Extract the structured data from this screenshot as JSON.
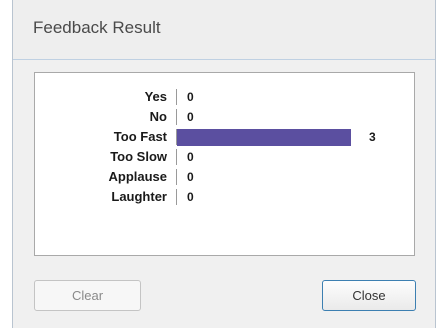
{
  "window": {
    "title": "Feedback Result"
  },
  "chart_data": {
    "type": "bar",
    "orientation": "horizontal",
    "categories": [
      "Yes",
      "No",
      "Too Fast",
      "Too Slow",
      "Applause",
      "Laughter"
    ],
    "values": [
      0,
      0,
      3,
      0,
      0,
      0
    ],
    "bar_color": "#5b4fa0",
    "xlim": [
      0,
      3
    ],
    "grid": false
  },
  "buttons": {
    "clear_label": "Clear",
    "clear_enabled": false,
    "close_label": "Close"
  }
}
